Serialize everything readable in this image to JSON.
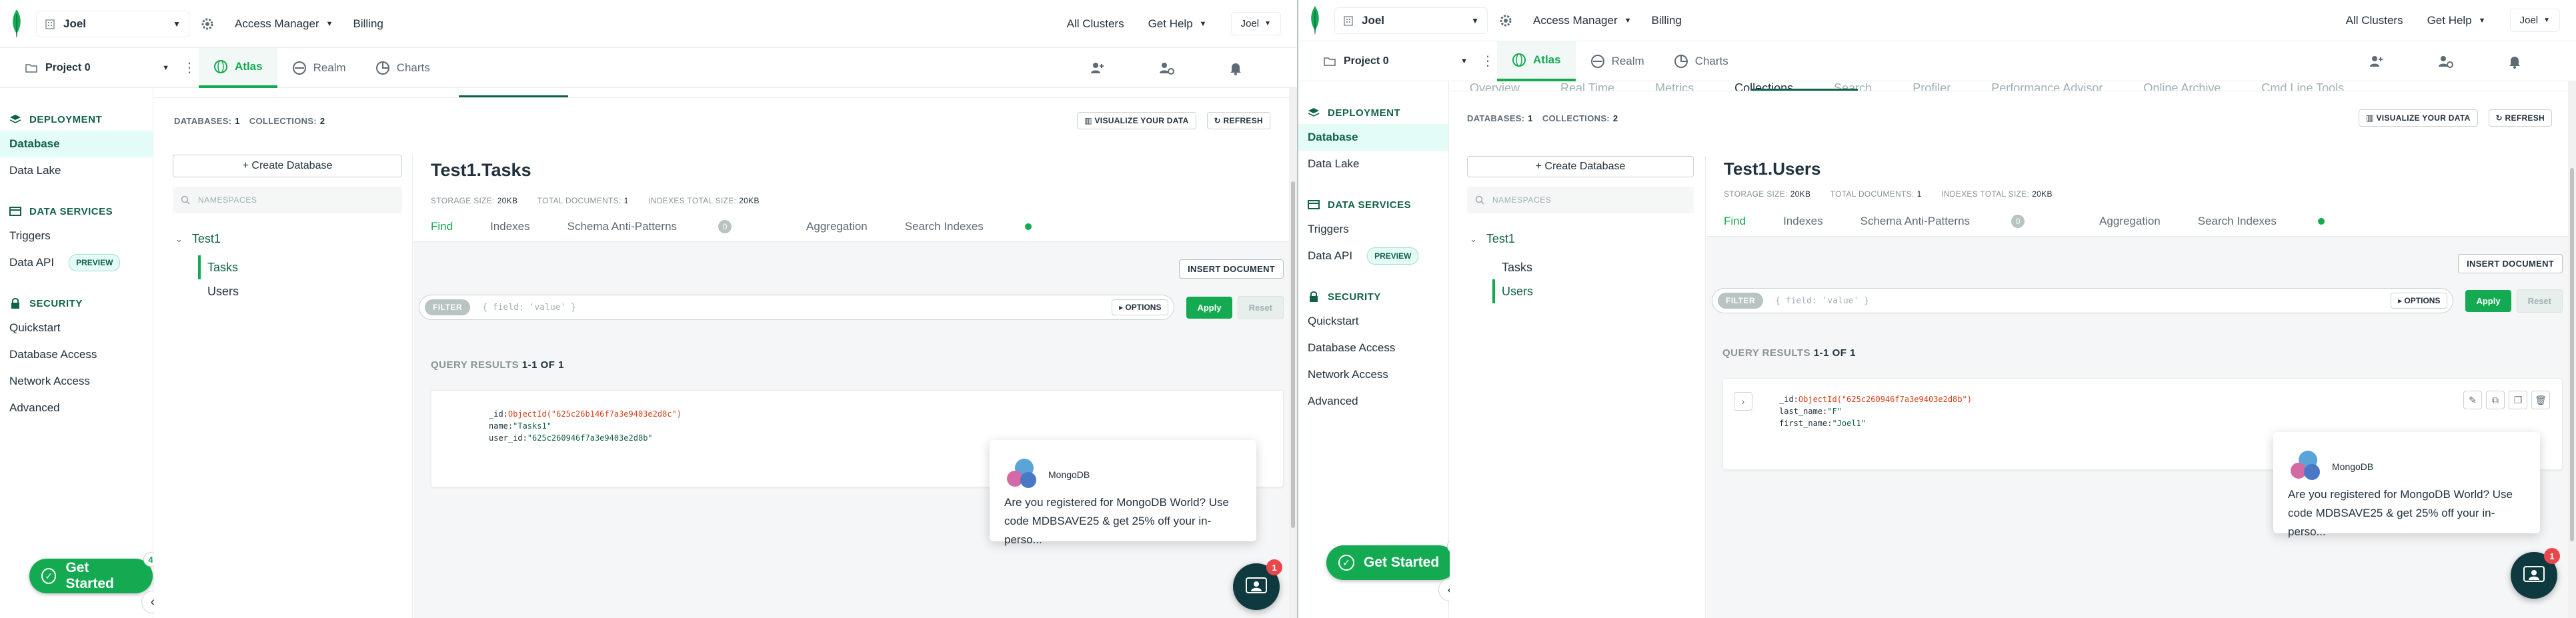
{
  "colors": {
    "brand_green": "#13aa52",
    "dark_green": "#116149",
    "text": "#21313c",
    "muted": "#889397"
  },
  "topbar": {
    "org_name": "Joel",
    "access_manager": "Access Manager",
    "billing": "Billing",
    "all_clusters": "All Clusters",
    "get_help": "Get Help",
    "user": "Joel"
  },
  "projbar": {
    "project_name": "Project 0",
    "tabs": [
      "Atlas",
      "Realm",
      "Charts"
    ]
  },
  "sidebar": {
    "deployment": "DEPLOYMENT",
    "database": "Database",
    "data_lake": "Data Lake",
    "data_services": "DATA SERVICES",
    "triggers": "Triggers",
    "data_api": "Data API",
    "preview": "PREVIEW",
    "security": "SECURITY",
    "quickstart": "Quickstart",
    "database_access": "Database Access",
    "network_access": "Network Access",
    "advanced": "Advanced",
    "get_started": "Get Started",
    "get_started_count": "4"
  },
  "cluster_tabs": [
    "Overview",
    "Real Time",
    "Metrics",
    "Collections",
    "Search",
    "Profiler",
    "Performance Advisor",
    "Online Archive",
    "Cmd Line Tools"
  ],
  "db_bar": {
    "databases_label": "DATABASES:",
    "databases_count": "1",
    "collections_label": "COLLECTIONS:",
    "collections_count": "2",
    "visualize": "VISUALIZE YOUR DATA",
    "refresh": "REFRESH"
  },
  "namespaces": {
    "create_db": "+ Create Database",
    "search_placeholder": "NAMESPACES",
    "db": "Test1",
    "collections": [
      "Tasks",
      "Users"
    ]
  },
  "collection_tabs": [
    "Find",
    "Indexes",
    "Schema Anti-Patterns",
    "Aggregation",
    "Search Indexes"
  ],
  "schema_badge": "0",
  "stats": {
    "storage_label": "STORAGE SIZE:",
    "storage": "20KB",
    "docs_label": "TOTAL DOCUMENTS:",
    "docs": "1",
    "indexes_label": "INDEXES TOTAL SIZE:",
    "indexes": "20KB"
  },
  "query": {
    "insert": "INSERT DOCUMENT",
    "filter": "FILTER",
    "filter_placeholder": "{ field: 'value' }",
    "options": "▸ OPTIONS",
    "apply": "Apply",
    "reset": "Reset",
    "results_label": "QUERY RESULTS",
    "results_range": "1-1 OF 1"
  },
  "left": {
    "title": "Test1.Tasks",
    "doc": {
      "id_key": "_id:",
      "id_val": "ObjectId(\"625c26b146f7a3e9403e2d8c\")",
      "k2": "name:",
      "v2": "\"Tasks1\"",
      "k3": "user_id:",
      "v3": "\"625c260946f7a3e9403e2d8b\""
    }
  },
  "right": {
    "title": "Test1.Users",
    "doc": {
      "id_key": "_id:",
      "id_val": "ObjectId(\"625c260946f7a3e9403e2d8b\")",
      "k2": "last_name:",
      "v2": "\"F\"",
      "k3": "first_name:",
      "v3": "\"Joel1\""
    }
  },
  "promo": {
    "sender": "MongoDB",
    "text": "Are you registered for MongoDB World? Use code MDBSAVE25 & get 25% off your in-perso...",
    "chat_count": "1"
  }
}
